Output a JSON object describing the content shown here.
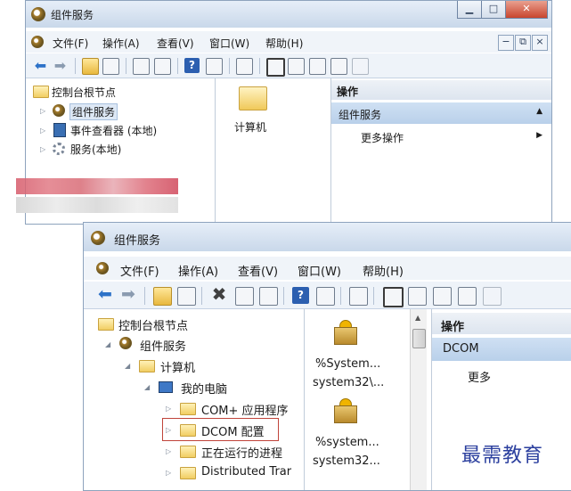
{
  "window1": {
    "title": "组件服务",
    "menu": [
      "文件(F)",
      "操作(A)",
      "查看(V)",
      "窗口(W)",
      "帮助(H)"
    ],
    "tree": {
      "root": "控制台根节点",
      "items": [
        "组件服务",
        "事件查看器 (本地)",
        "服务(本地)"
      ]
    },
    "center": {
      "item": "计算机"
    },
    "actions": {
      "header": "操作",
      "selected": "组件服务",
      "more": "更多操作"
    }
  },
  "window2": {
    "title": "组件服务",
    "menu": [
      "文件(F)",
      "操作(A)",
      "查看(V)",
      "窗口(W)",
      "帮助(H)"
    ],
    "tree": {
      "root": "控制台根节点",
      "items": [
        "组件服务",
        "计算机",
        "我的电脑",
        "COM+ 应用程序",
        "DCOM 配置",
        "正在运行的进程",
        "Distributed Trar"
      ]
    },
    "center": {
      "items": [
        {
          "line1": "%System...",
          "line2": "system32\\..."
        },
        {
          "line1": "%system...",
          "line2": "system32..."
        }
      ]
    },
    "actions": {
      "header": "操作",
      "selected": "DCOM",
      "more": "更多"
    }
  },
  "watermark": "最需教育",
  "colors": {
    "accent": "#2c5fb0",
    "highlight_border": "#c0443a",
    "selection": "#b9d0ea"
  }
}
